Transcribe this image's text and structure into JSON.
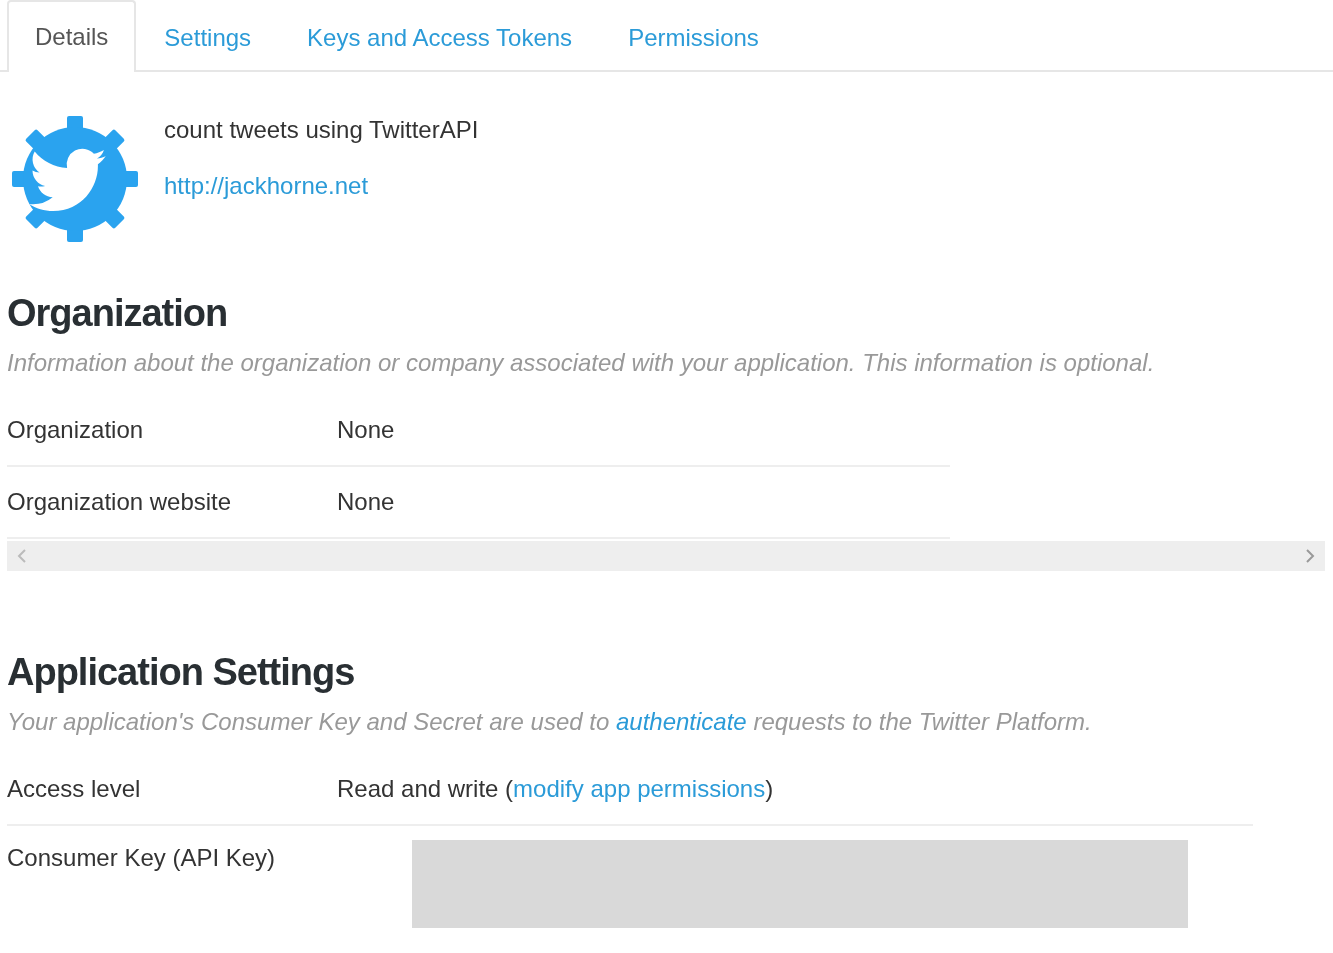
{
  "tabs": [
    {
      "label": "Details",
      "selected": true
    },
    {
      "label": "Settings",
      "selected": false
    },
    {
      "label": "Keys and Access Tokens",
      "selected": false
    },
    {
      "label": "Permissions",
      "selected": false
    }
  ],
  "app": {
    "name": "count tweets using TwitterAPI",
    "url": "http://jackhorne.net"
  },
  "organization": {
    "heading": "Organization",
    "description": "Information about the organization or company associated with your application. This information is optional.",
    "rows": [
      {
        "label": "Organization",
        "value": "None"
      },
      {
        "label": "Organization website",
        "value": "None"
      }
    ]
  },
  "application_settings": {
    "heading": "Application Settings",
    "description_before": "Your application's Consumer Key and Secret are used to ",
    "description_link": "authenticate",
    "description_after": " requests to the Twitter Platform.",
    "rows": [
      {
        "kind": "text-with-link",
        "label": "Access level",
        "value_before": "Read and write (",
        "link": "modify app permissions",
        "value_after": ")"
      },
      {
        "kind": "redacted",
        "label": "Consumer Key (API Key)"
      }
    ]
  }
}
